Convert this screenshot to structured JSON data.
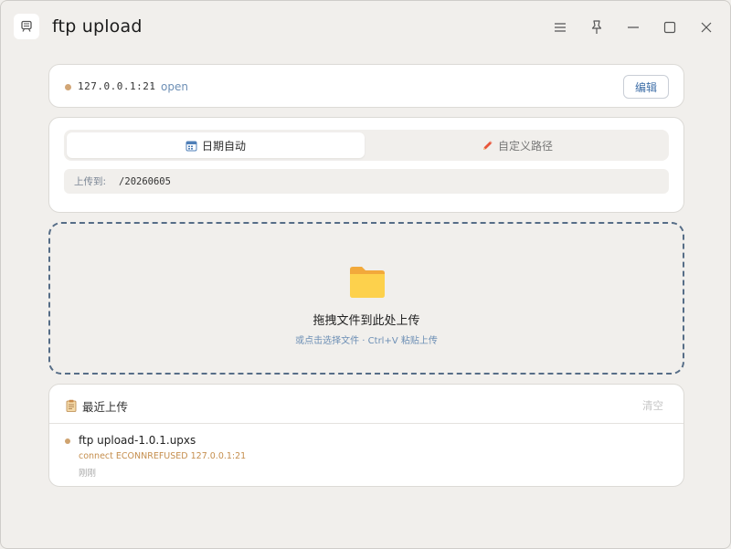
{
  "app": {
    "title": "ftp upload",
    "icon": "ftp-app-icon"
  },
  "titlebar": {
    "buttons": [
      "menu-icon",
      "pin-icon",
      "minimize-icon",
      "maximize-icon",
      "close-icon"
    ]
  },
  "connection": {
    "host": "127.0.0.1:21",
    "separator": "·",
    "mode": "open",
    "status_color": "#d2a676",
    "edit_label": "编辑"
  },
  "mode": {
    "tabs": [
      {
        "label": "日期自动",
        "icon": "calendar-icon",
        "active": true
      },
      {
        "label": "自定义路径",
        "icon": "pencil-icon",
        "active": false
      }
    ],
    "path_label": "上传到:",
    "path_value": "/20260605"
  },
  "dropzone": {
    "icon": "folder-icon",
    "title": "拖拽文件到此处上传",
    "hint": "或点击选择文件 · Ctrl+V 粘贴上传"
  },
  "recent": {
    "title": "最近上传",
    "icon": "clipboard-icon",
    "clear_label": "清空",
    "items": [
      {
        "name": "ftp upload-1.0.1.upxs",
        "error": "connect ECONNREFUSED 127.0.0.1:21",
        "time": "刚刚",
        "status_color": "#cfa36f"
      }
    ]
  },
  "colors": {
    "background": "#f1efec",
    "accent": "#3f6fa8",
    "link": "#6d8fb5",
    "warning": "#c58e4d"
  }
}
